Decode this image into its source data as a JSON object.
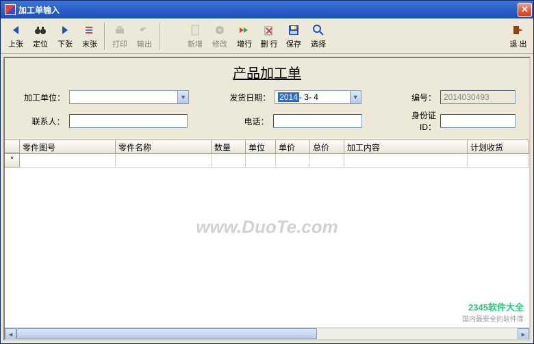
{
  "window": {
    "title": "加工单输入"
  },
  "toolbar": {
    "prev": "上张",
    "locate": "定位",
    "next": "下张",
    "last": "末张",
    "print": "打印",
    "export": "输出",
    "new": "新增",
    "edit": "修改",
    "addRow": "增行",
    "delRow": "删 行",
    "save": "保存",
    "select": "选择",
    "exit": "退 出"
  },
  "form": {
    "title": "产品加工单",
    "labels": {
      "unit": "加工单位：",
      "shipDate": "发货日期：",
      "serial": "编号：",
      "contact": "联系人：",
      "phone": "电话：",
      "idcard": "身份证ID："
    },
    "values": {
      "unit": "",
      "shipDateYear": "2014",
      "shipDateRest": "- 3- 4",
      "serial": "2014030493",
      "contact": "",
      "phone": "",
      "idcard": ""
    }
  },
  "grid": {
    "cols": [
      "零件图号",
      "零件名称",
      "数量",
      "单位",
      "单价",
      "总价",
      "加工内容",
      "计划收货"
    ],
    "widths": [
      22,
      140,
      140,
      50,
      44,
      50,
      50,
      180,
      48
    ],
    "rowMarker": "*"
  },
  "watermark": "www.DuoTe.com",
  "brand": {
    "name": "2345软件大全",
    "sub": "国内最安全的软件库"
  }
}
